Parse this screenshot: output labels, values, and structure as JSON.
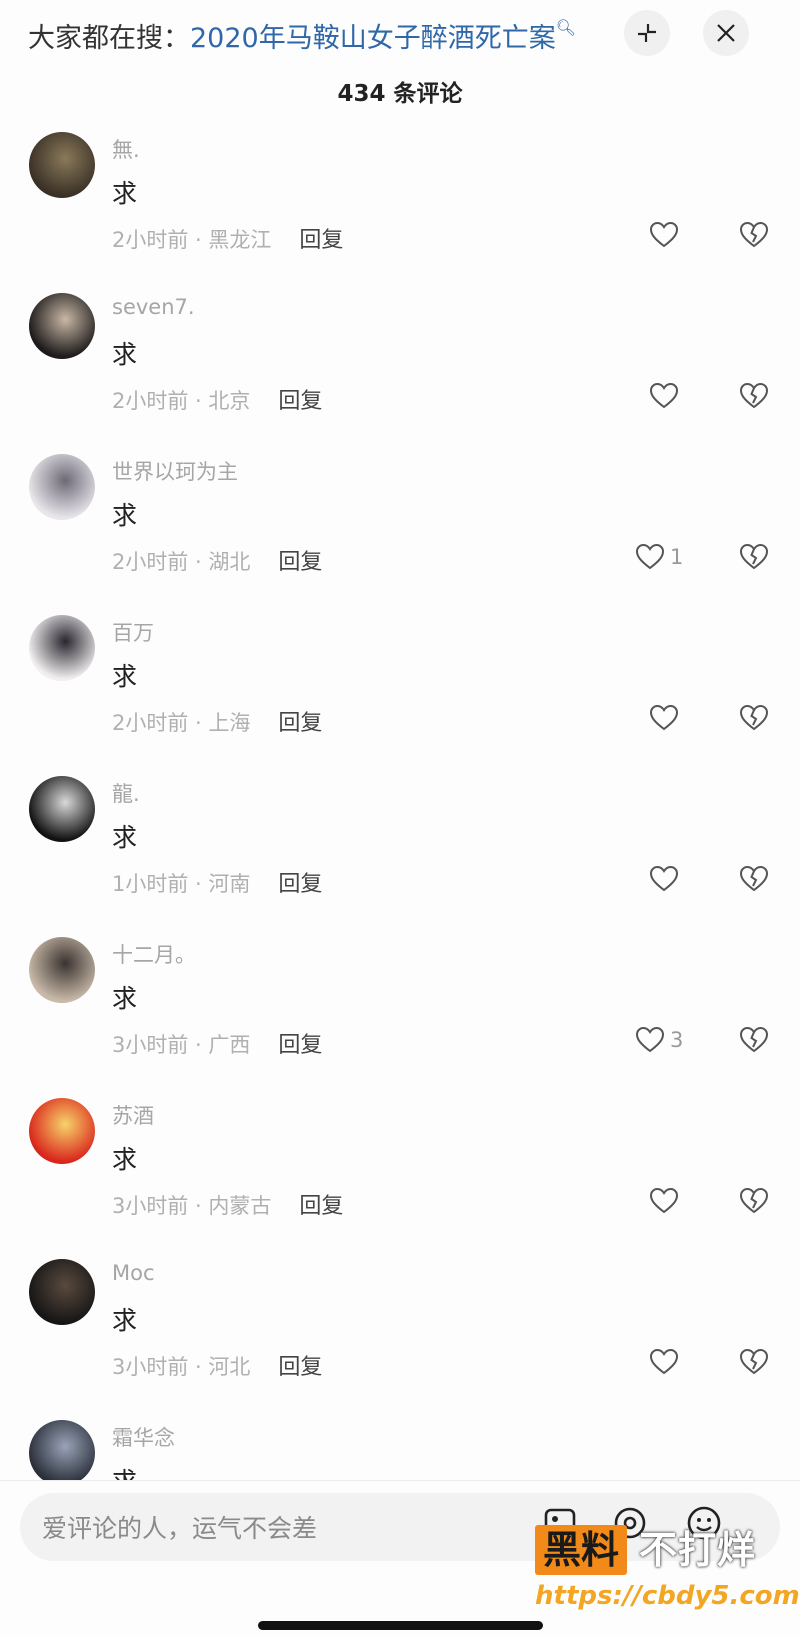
{
  "search": {
    "prefix": "大家都在搜：",
    "query": "2020年马鞍山女子醉酒死亡案"
  },
  "header": {
    "count_label": "434 条评论"
  },
  "comments": [
    {
      "name": "無.",
      "text": "求",
      "time": "2小时前 · 黑龙江",
      "reply": "回复",
      "likes": "",
      "avatar": [
        "#3a3026",
        "#8a7a5a"
      ]
    },
    {
      "name": "seven7.",
      "text": "求",
      "time": "2小时前 · 北京",
      "reply": "回复",
      "likes": "",
      "avatar": [
        "#1c1a1a",
        "#c9b8a6"
      ]
    },
    {
      "name": "世界以珂为主",
      "text": "求",
      "time": "2小时前 · 湖北",
      "reply": "回复",
      "likes": "1",
      "avatar": [
        "#e8e6ea",
        "#6d6a78"
      ]
    },
    {
      "name": "百万",
      "text": "求",
      "time": "2小时前 · 上海",
      "reply": "回复",
      "likes": "",
      "avatar": [
        "#f0eeee",
        "#2a2630"
      ]
    },
    {
      "name": "龍.",
      "text": "求",
      "time": "1小时前 · 河南",
      "reply": "回复",
      "likes": "",
      "avatar": [
        "#121212",
        "#d9d9d9"
      ]
    },
    {
      "name": "十二月。",
      "text": "求",
      "time": "3小时前 · 广西",
      "reply": "回复",
      "likes": "3",
      "avatar": [
        "#c8b9a8",
        "#3a3330"
      ]
    },
    {
      "name": "苏酒",
      "text": "求",
      "time": "3小时前 · 内蒙古",
      "reply": "回复",
      "likes": "",
      "avatar": [
        "#d9261c",
        "#f7d36a"
      ]
    },
    {
      "name": "Moc",
      "text": "求",
      "time": "3小时前 · 河北",
      "reply": "回复",
      "likes": "",
      "avatar": [
        "#161616",
        "#5a4a3e"
      ]
    },
    {
      "name": "霜华念",
      "text": "求",
      "time": "",
      "reply": "",
      "likes": "",
      "avatar": [
        "#2a2f3a",
        "#9aa4b8"
      ]
    }
  ],
  "input": {
    "placeholder": "爱评论的人，运气不会差"
  },
  "watermark": {
    "badge": "黑料",
    "text": "不打烊",
    "url": "https://cbdy5.com"
  }
}
